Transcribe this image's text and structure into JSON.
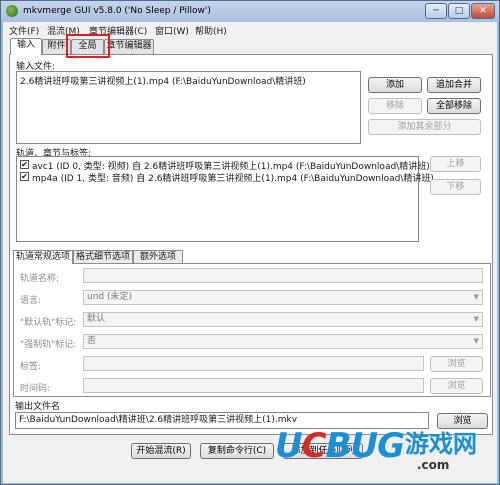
{
  "window": {
    "title": "mkvmerge GUI v5.8.0 ('No Sleep / Pillow')",
    "minimize_glyph": "─",
    "maximize_glyph": "□",
    "close_glyph": "✕"
  },
  "menu": {
    "items": [
      {
        "label": "文件(F)"
      },
      {
        "label": "混流(M)"
      },
      {
        "label": "章节编辑器(C)"
      },
      {
        "label": "窗口(W)"
      },
      {
        "label": "帮助(H)"
      }
    ]
  },
  "tabs": [
    {
      "label": "输入"
    },
    {
      "label": "附件"
    },
    {
      "label": "全局"
    },
    {
      "label": "章节编辑器"
    }
  ],
  "input_files": {
    "label": "输入文件:",
    "items": [
      "2.6精讲班呼吸第三讲视频上(1).mp4 (F:\\BaiduYunDownload\\精讲班)"
    ],
    "add_button": "添加",
    "append_button": "追加合并",
    "remove_button": "移除",
    "remove_all_button": "全部移除",
    "add_extra_button": "添加其余部分"
  },
  "tracks": {
    "label": "轨道、章节与标签:",
    "items": [
      {
        "text": "avc1 (ID 0, 类型: 视频) 自 2.6精讲班呼吸第三讲视频上(1).mp4 (F:\\BaiduYunDownload\\精讲班)",
        "checked": true
      },
      {
        "text": "mp4a (ID 1, 类型: 音频) 自 2.6精讲班呼吸第三讲视频上(1).mp4 (F:\\BaiduYunDownload\\精讲班)",
        "checked": true
      }
    ],
    "up_button": "上移",
    "down_button": "下移"
  },
  "track_options": {
    "subtabs": [
      {
        "label": "轨道常规选项"
      },
      {
        "label": "格式细节选项"
      },
      {
        "label": "额外选项"
      }
    ],
    "track_name_label": "轨道名称:",
    "language_label": "语言:",
    "language_value": "und (未定)",
    "default_flag_label": "\"默认轨\"标记:",
    "default_flag_value": "默认",
    "forced_flag_label": "\"强制轨\"标记:",
    "forced_flag_value": "否",
    "tags_label": "标签:",
    "tags_browse": "浏览",
    "timecodes_label": "时间码:",
    "timecodes_browse": "浏览"
  },
  "output": {
    "label": "输出文件名",
    "path": "F:\\BaiduYunDownload\\精讲班\\2.6精讲班呼吸第三讲视频上(1).mkv",
    "browse_button": "浏览"
  },
  "actions": {
    "start_mux": "开始混流(R)",
    "copy_cmdline": "复制命令行(C)",
    "add_to_job": "添加到任务队列"
  },
  "watermark": {
    "logo_u": "U",
    "logo_c": "C",
    "logo_bug": "BUG",
    "cn": "游戏网",
    "url": ".com"
  }
}
